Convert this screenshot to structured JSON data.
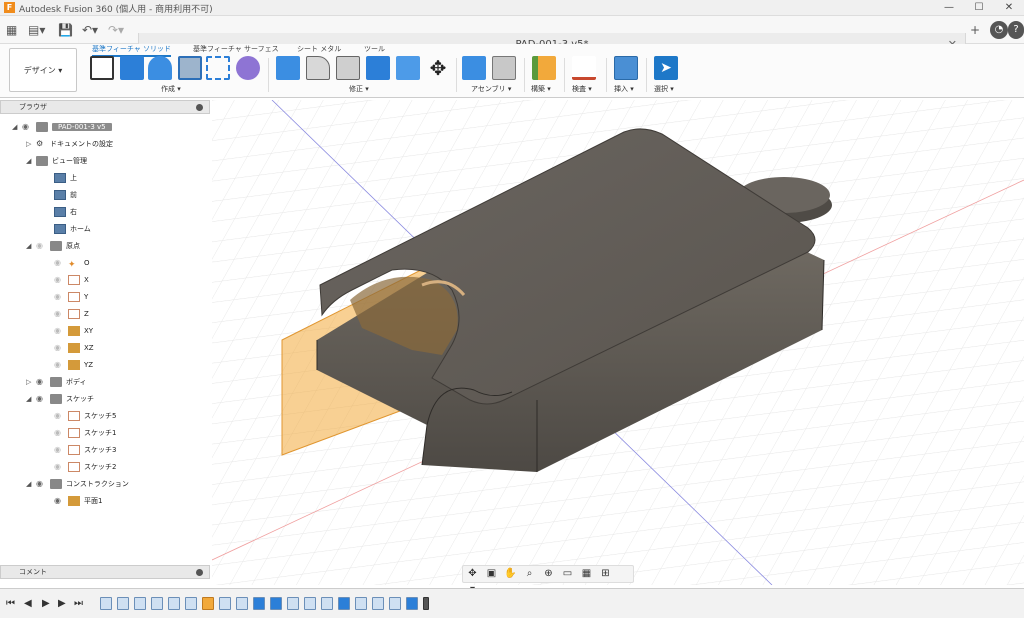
{
  "app": {
    "title": "Autodesk Fusion 360 (個人用 - 商用利用不可)",
    "logo": "F"
  },
  "document": {
    "tab_title": "PAD-001-3 v5*"
  },
  "toolbar": {
    "workspace": "デザイン ▾",
    "tabs": [
      "基準フィーチャ ソリッド",
      "基準フィーチャ サーフェス",
      "シート メタル",
      "ツール"
    ],
    "groups": {
      "create": "作成 ▾",
      "modify": "修正 ▾",
      "assemble": "アセンブリ ▾",
      "construct": "構築 ▾",
      "inspect": "検査 ▾",
      "insert": "挿入 ▾",
      "select": "選択 ▾"
    }
  },
  "browser": {
    "title": "ブラウザ",
    "root": "PAD-001-3 v5",
    "doc_settings": "ドキュメントの設定",
    "named_views": "ビュー管理",
    "views": [
      "上",
      "前",
      "右",
      "ホーム"
    ],
    "origin": "原点",
    "origin_items": [
      "O",
      "X",
      "Y",
      "Z",
      "XY",
      "XZ",
      "YZ"
    ],
    "bodies": "ボディ",
    "sketches": "スケッチ",
    "sketch_items": [
      "スケッチ5",
      "スケッチ1",
      "スケッチ3",
      "スケッチ2"
    ],
    "construction": "コンストラクション",
    "construction_items": [
      "平面1"
    ]
  },
  "comments": {
    "title": "コメント"
  },
  "colors": {
    "accent": "#1e78c8",
    "plane": "#f2a93b",
    "body": "#6f6a62"
  }
}
